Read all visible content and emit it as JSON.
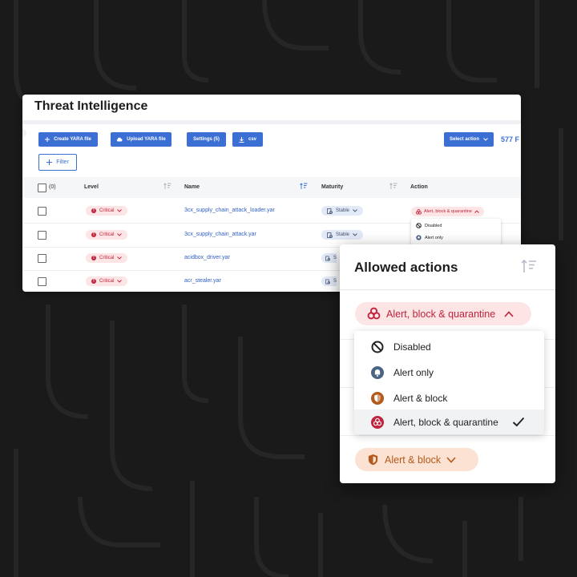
{
  "colors": {
    "background": "#1a1a1a",
    "primary": "#3b6fd4",
    "critical": "#c0233b",
    "critical_bg": "#fde5e6",
    "stable_bg": "#e2e9f7",
    "alert_block": "#b45a1c",
    "alert_block_bg": "#fbe2d2"
  },
  "panel": {
    "title": "Threat Intelligence",
    "toolbar": {
      "create_yara": "Create YARA file",
      "upload_yara": "Upload YARA file",
      "settings": "Settings (5)",
      "csv": "csv",
      "select_action": "Select action",
      "count": "577 F",
      "filter": "Filter"
    },
    "table": {
      "select_count": "(0)",
      "columns": [
        "Level",
        "Name",
        "Maturity",
        "Action"
      ],
      "rows": [
        {
          "level": "Critical",
          "name": "3cx_supply_chain_attack_loader.yar",
          "maturity": "Stable"
        },
        {
          "level": "Critical",
          "name": "3cx_supply_chain_attack.yar",
          "maturity": "Stable"
        },
        {
          "level": "Critical",
          "name": "acidbox_driver.yar",
          "maturity": "S"
        },
        {
          "level": "Critical",
          "name": "acr_stealer.yar",
          "maturity": "S"
        }
      ],
      "first_row_action": "Alert, block & quarantine",
      "action_menu": [
        "Disabled",
        "Alert only"
      ]
    }
  },
  "card": {
    "title": "Allowed actions",
    "current_action": "Alert, block & quarantine",
    "options": [
      {
        "label": "Disabled",
        "icon": "disabled-icon",
        "selected": false
      },
      {
        "label": "Alert only",
        "icon": "bell-icon",
        "selected": false
      },
      {
        "label": "Alert & block",
        "icon": "shield-icon",
        "selected": false
      },
      {
        "label": "Alert, block & quarantine",
        "icon": "biohazard-icon",
        "selected": true
      }
    ],
    "second_action": "Alert & block"
  }
}
